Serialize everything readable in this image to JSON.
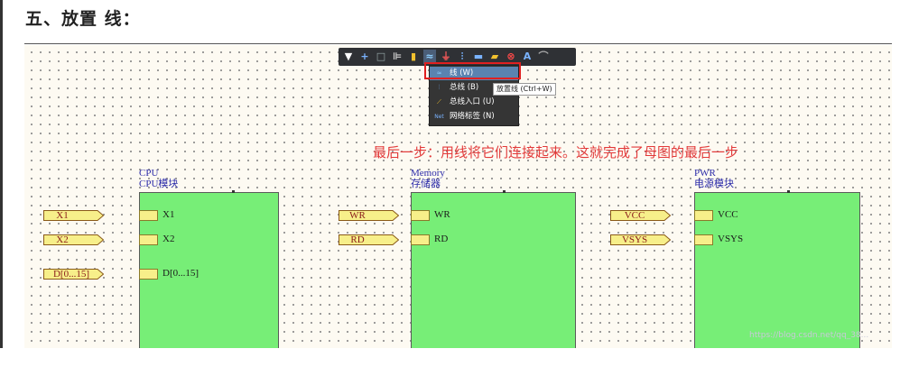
{
  "heading": "五、放置 线：",
  "toolbar": {
    "icons": [
      "filter-icon",
      "plus-icon",
      "rectangle-icon",
      "align-icon",
      "part-icon",
      "wire-icon",
      "power-icon",
      "bus-icon",
      "harness-icon",
      "port-icon",
      "no-erc-icon",
      "text-icon",
      "arc-icon"
    ]
  },
  "menu": {
    "items": [
      {
        "label": "线 (W)",
        "icon": "wire-icon"
      },
      {
        "label": "总线 (B)",
        "icon": "bus-icon"
      },
      {
        "label": "总线入口 (U)",
        "icon": "bus-entry-icon"
      },
      {
        "label": "网络标签 (N)",
        "icon": "net-label-icon"
      }
    ],
    "net_icon_text": "Net",
    "tooltip": "放置线 (Ctrl+W)"
  },
  "note": "最后一步：用线将它们连接起来。这就完成了母图的最后一步",
  "sheets": [
    {
      "name": "CPU",
      "file": "CPU模块",
      "entries": [
        "X1",
        "X2",
        "D[0...15]"
      ],
      "ports": [
        "X1",
        "X2",
        "D[0...15]"
      ]
    },
    {
      "name": "Memory",
      "file": "存储器",
      "entries": [
        "WR",
        "RD"
      ],
      "ports": [
        "WR",
        "RD"
      ]
    },
    {
      "name": "PWR",
      "file": "电源模块",
      "entries": [
        "VCC",
        "VSYS"
      ],
      "ports": [
        "VCC",
        "VSYS"
      ]
    }
  ],
  "watermark": "https://blog.csdn.net/qq_38...",
  "colors": {
    "sheet_fill": "#77ee77",
    "port_fill": "#f7ef8a",
    "note": "#e23a3a",
    "highlight": "#e02020"
  }
}
